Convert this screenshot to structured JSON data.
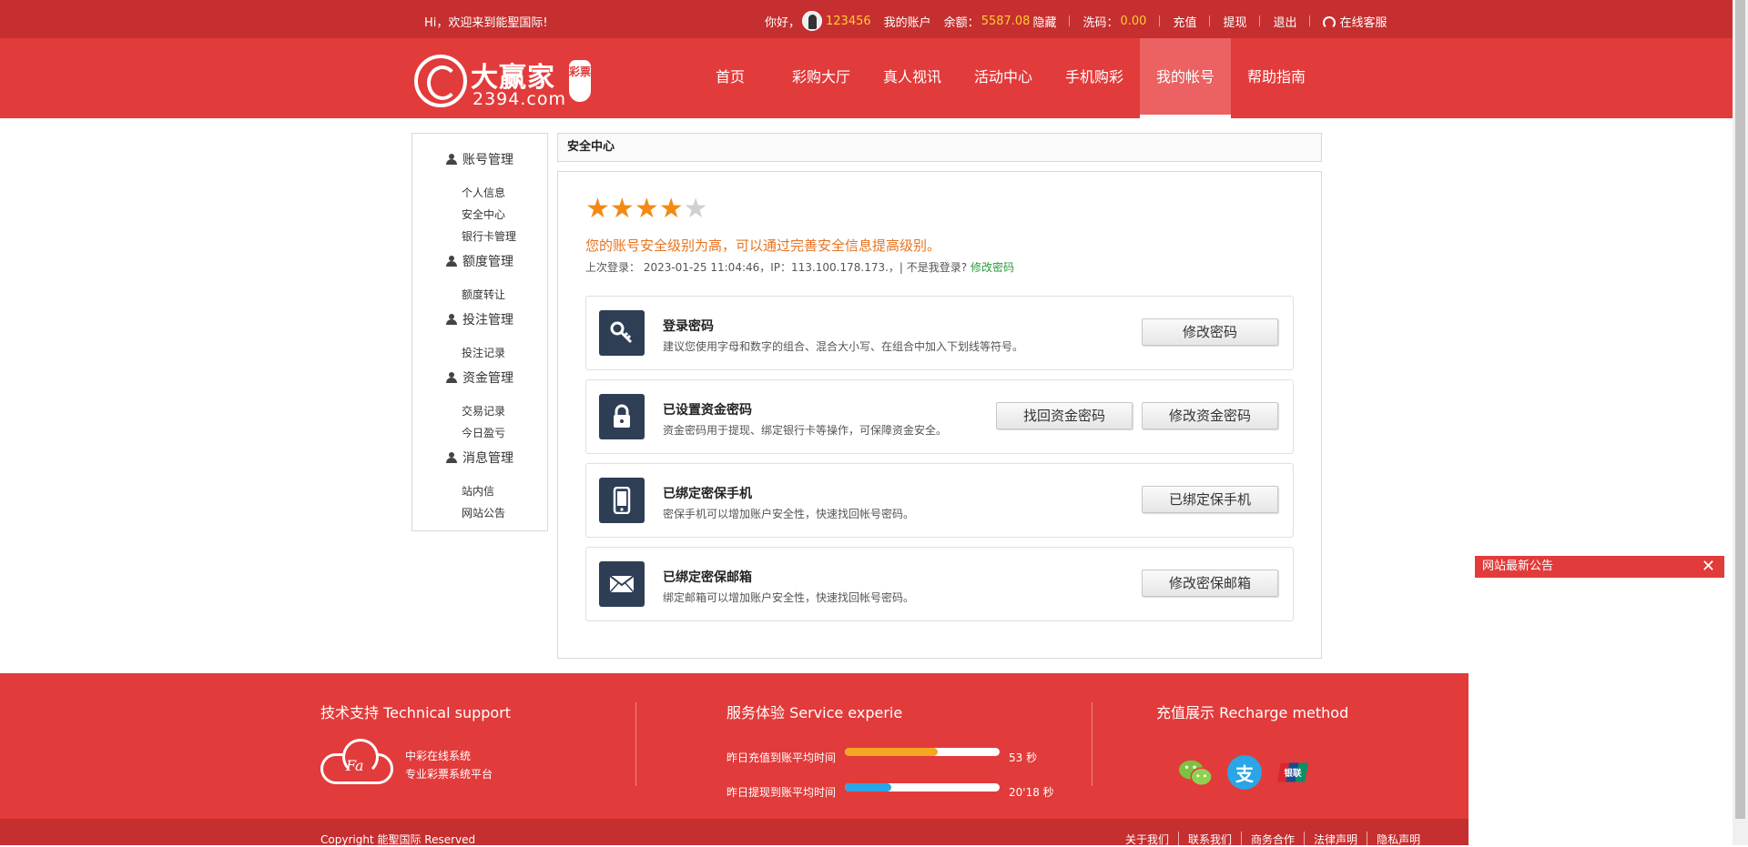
{
  "topbar": {
    "greeting": "Hi，欢迎来到能聖国际!",
    "hello": "你好，",
    "username": "123456",
    "my_account": "我的账户",
    "balance_label": "余额：",
    "balance_value": "5587.08",
    "hide": "隐藏",
    "wash_label": "洗码：",
    "wash_value": "0.00",
    "recharge": "充值",
    "withdraw": "提现",
    "logout": "退出",
    "service": "在线客服"
  },
  "logo": {
    "cn": "大赢家",
    "en": "2394.com",
    "badge": "彩票"
  },
  "nav": [
    "首页",
    "彩购大厅",
    "真人视讯",
    "活动中心",
    "手机购彩",
    "我的帐号",
    "帮助指南"
  ],
  "sidebar": {
    "groups": [
      {
        "title": "账号管理",
        "links": [
          "个人信息",
          "安全中心",
          "银行卡管理"
        ]
      },
      {
        "title": "额度管理",
        "links": [
          "额度转让"
        ]
      },
      {
        "title": "投注管理",
        "links": [
          "投注记录"
        ]
      },
      {
        "title": "资金管理",
        "links": [
          "交易记录",
          "今日盈亏"
        ]
      },
      {
        "title": "消息管理",
        "links": [
          "站内信",
          "网站公告"
        ]
      }
    ]
  },
  "security": {
    "title": "安全中心",
    "stars_filled": 4,
    "stars_total": 5,
    "level_text": "您的账号安全级别为高，可以通过完善安全信息提高级别。",
    "last_login_prefix": "上次登录：  2023-01-25 11:04:46，IP：113.100.178.173.，| 不是我登录?",
    "change_pwd_link": "修改密码",
    "rows": [
      {
        "icon": "key-icon",
        "title": "登录密码",
        "desc": "建议您使用字母和数字的组合、混合大小写、在组合中加入下划线等符号。",
        "buttons": [
          "修改密码"
        ]
      },
      {
        "icon": "lock-icon",
        "title": "已设置资金密码",
        "desc": "资金密码用于提现、绑定银行卡等操作，可保障资金安全。",
        "buttons": [
          "找回资金密码",
          "修改资金密码"
        ]
      },
      {
        "icon": "phone-icon",
        "title": "已绑定密保手机",
        "desc": "密保手机可以增加账户安全性，快速找回帐号密码。",
        "buttons": [
          "已绑定保手机"
        ]
      },
      {
        "icon": "mail-icon",
        "title": "已绑定密保邮箱",
        "desc": "绑定邮箱可以增加账户安全性，快速找回帐号密码。",
        "buttons": [
          "修改密保邮箱"
        ]
      }
    ]
  },
  "notice": {
    "title": "网站最新公告",
    "close": "✕"
  },
  "footer": {
    "col1_title": "技术支持 Technical support",
    "cloud_text": "Fa",
    "line1": "中彩在线系统",
    "line2": "专业彩票系统平台",
    "col2_title": "服务体验 Service experie",
    "stat1_label": "昨日充值到账平均时间",
    "stat1_value": "53 秒",
    "stat1_fill": 0.6,
    "stat2_label": "昨日提现到账平均时间",
    "stat2_value": "20'18 秒",
    "stat2_fill": 0.3,
    "col3_title": "充值展示 Recharge method",
    "copyright": "Copyright 能聖国际 Reserved",
    "links": [
      "关于我们",
      "联系我们",
      "商务合作",
      "法律声明",
      "隐私声明"
    ],
    "colors": {
      "bar1": "#f5a623",
      "bar2": "#2aa5e6",
      "wechat": "#7cc242",
      "alipay": "#2aa5e6"
    }
  }
}
